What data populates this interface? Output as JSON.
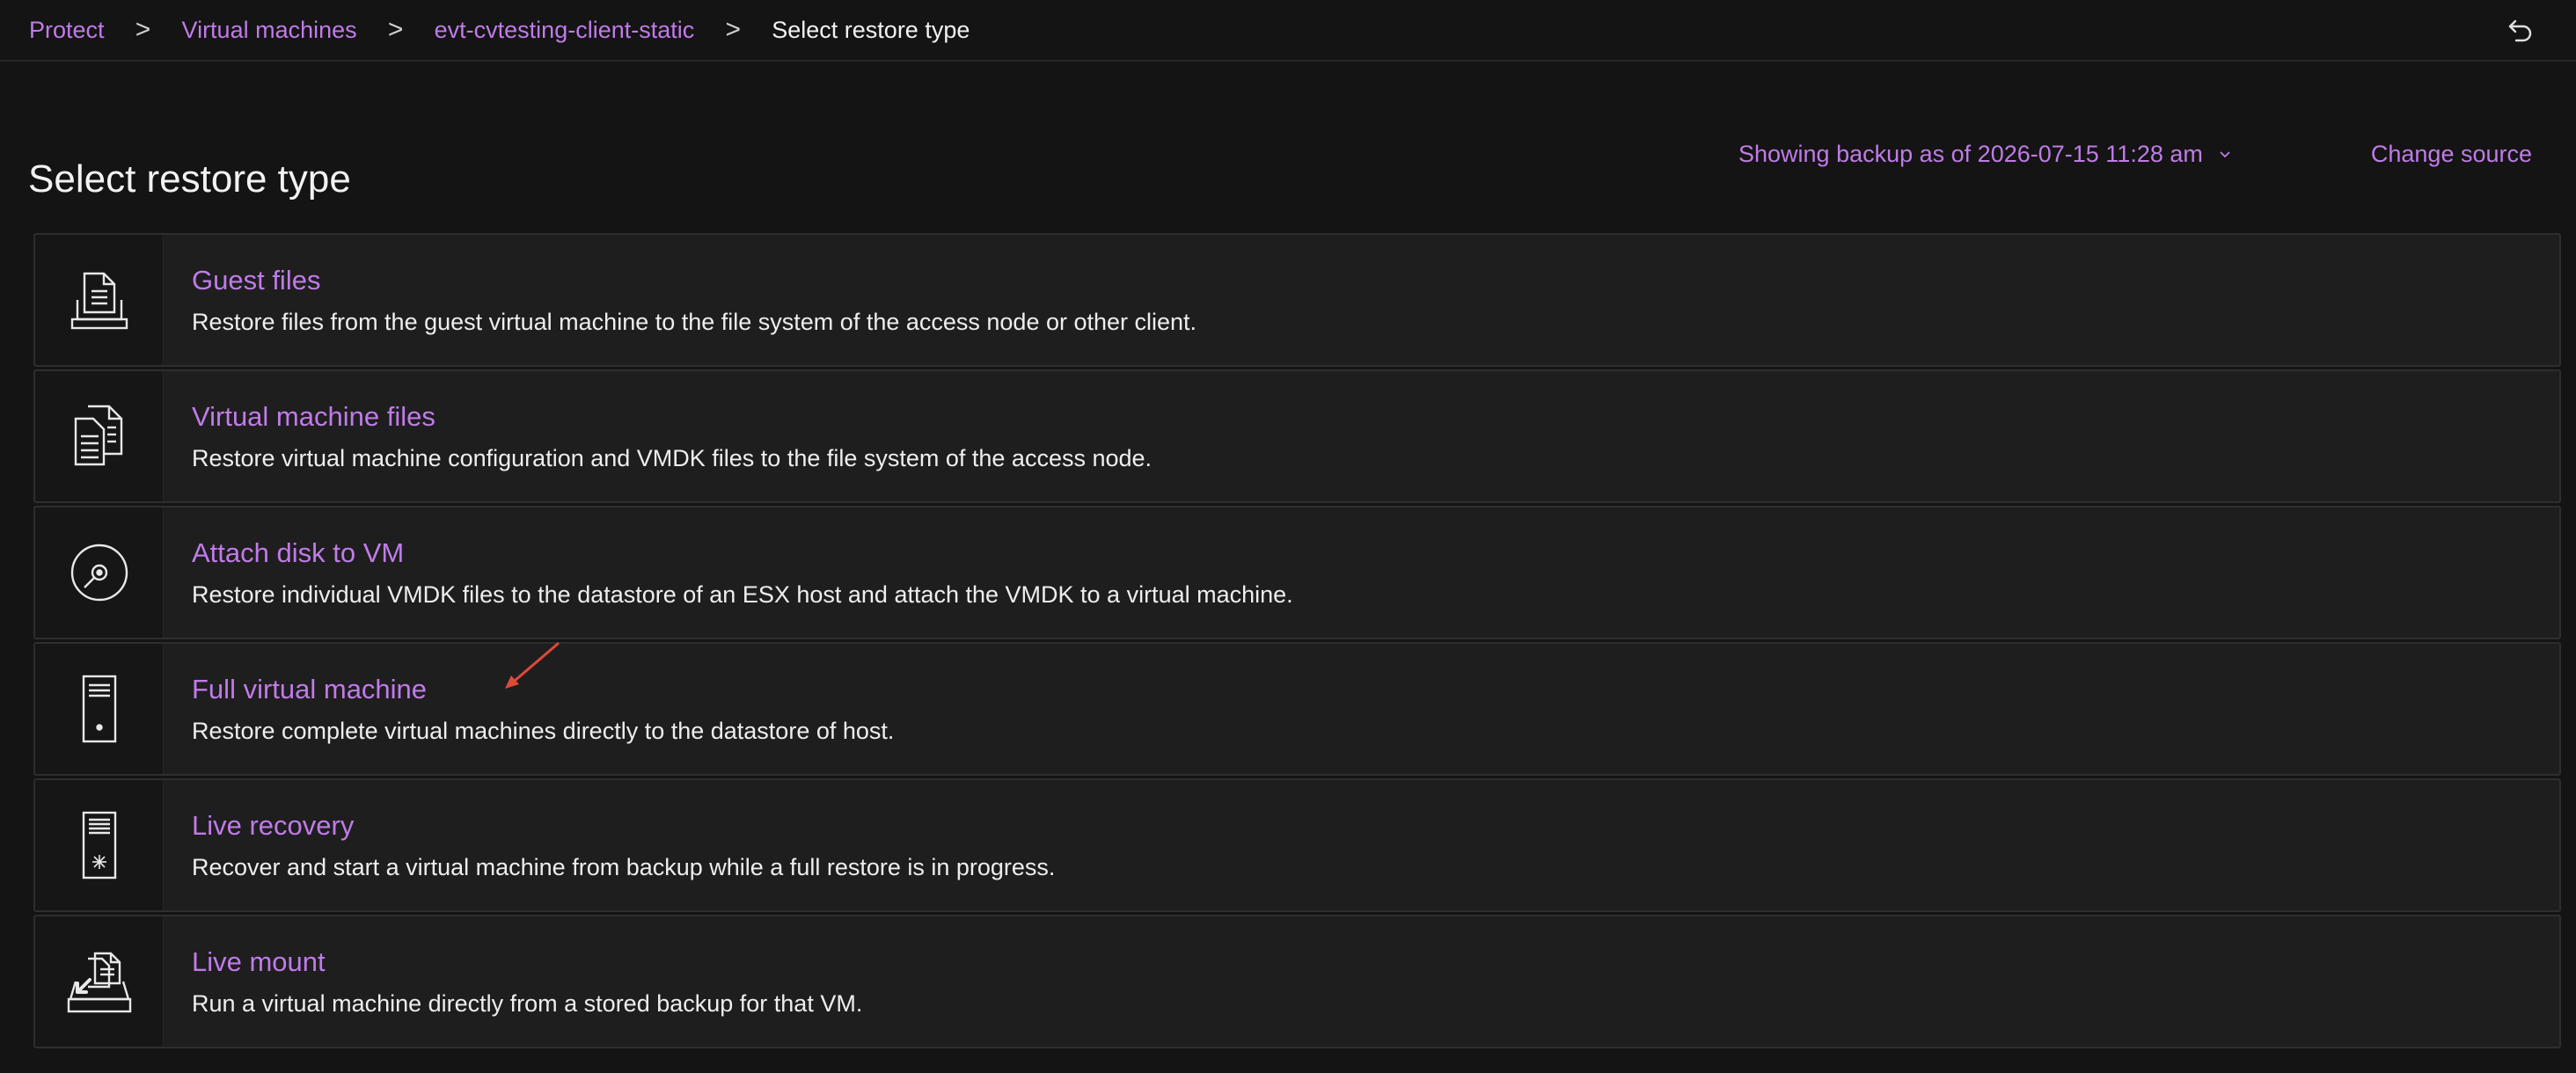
{
  "breadcrumb": {
    "items": [
      "Protect",
      "Virtual machines",
      "evt-cvtesting-client-static"
    ],
    "current": "Select restore type",
    "separator": ">"
  },
  "header": {
    "title": "Select restore type",
    "backup_as_of": "Showing backup as of 2026-07-15 11:28 am",
    "change_source": "Change source"
  },
  "options": [
    {
      "icon": "guest-files-icon",
      "title": "Guest files",
      "description": "Restore files from the guest virtual machine to the file system of the access node or other client."
    },
    {
      "icon": "vm-files-icon",
      "title": "Virtual machine files",
      "description": "Restore virtual machine configuration and VMDK files to the file system of the access node."
    },
    {
      "icon": "disk-icon",
      "title": "Attach disk to VM",
      "description": "Restore individual VMDK files to the datastore of an ESX host and attach the VMDK to a virtual machine."
    },
    {
      "icon": "server-icon",
      "title": "Full virtual machine",
      "description": "Restore complete virtual machines directly to the datastore of host."
    },
    {
      "icon": "live-recovery-icon",
      "title": "Live recovery",
      "description": "Recover and start a virtual machine from backup while a full restore is in progress."
    },
    {
      "icon": "live-mount-icon",
      "title": "Live mount",
      "description": "Run a virtual machine directly from a stored backup for that VM."
    }
  ],
  "colors": {
    "accent": "#c07be8",
    "background": "#141414",
    "card": "#1e1e1e",
    "annotation_arrow": "#e0483a"
  }
}
